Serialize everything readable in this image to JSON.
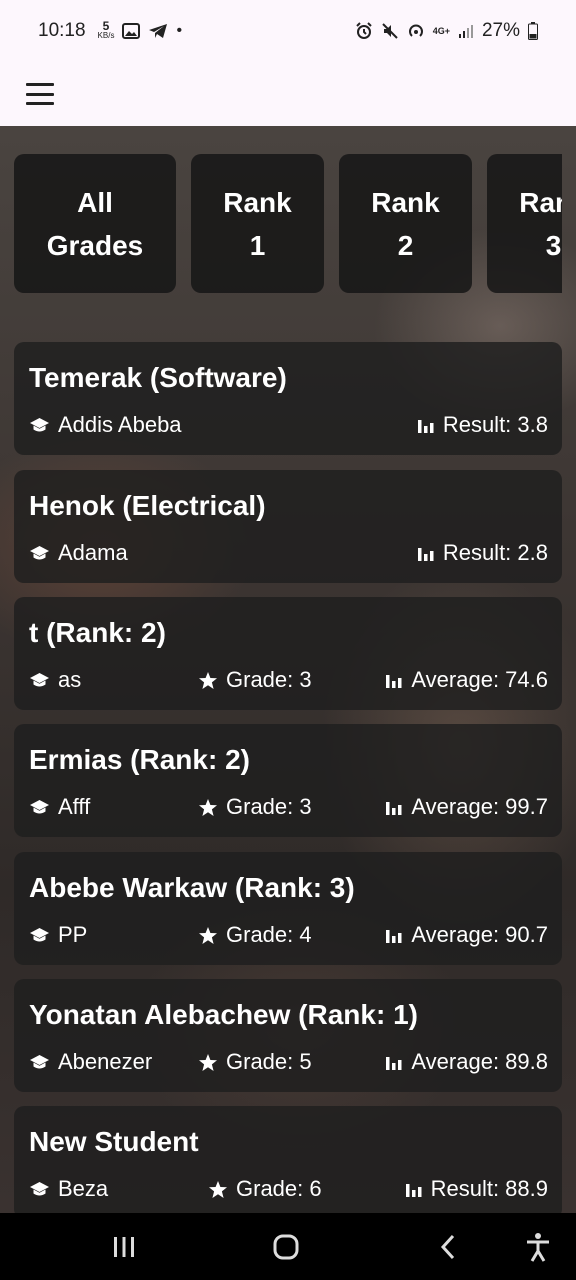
{
  "status_bar": {
    "time": "10:18",
    "net_speed": "5",
    "net_unit": "KB/s",
    "left_icons": [
      "image-icon",
      "telegram-icon",
      "dot-icon"
    ],
    "right_icons": [
      "alarm-icon",
      "mute-icon",
      "hotspot-icon",
      "lte-icon",
      "signal-icon"
    ],
    "network": "4G+",
    "battery": "27%"
  },
  "filters": [
    {
      "line1": "All",
      "line2": "Grades"
    },
    {
      "line1": "Rank",
      "line2": "1"
    },
    {
      "line1": "Rank",
      "line2": "2"
    },
    {
      "line1": "Rank",
      "line2": "3"
    }
  ],
  "students": [
    {
      "title": "Temerak (Software)",
      "school": "Addis Abeba",
      "grade": "",
      "score": "Result: 3.8"
    },
    {
      "title": "Henok (Electrical)",
      "school": "Adama",
      "grade": "",
      "score": "Result: 2.8"
    },
    {
      "title": "t (Rank: 2)",
      "school": "as",
      "grade": "Grade: 3",
      "score": "Average: 74.6"
    },
    {
      "title": "Ermias (Rank: 2)",
      "school": "Afff",
      "grade": "Grade: 3",
      "score": "Average: 99.7"
    },
    {
      "title": "Abebe Warkaw (Rank: 3)",
      "school": "PP",
      "grade": "Grade: 4",
      "score": "Average: 90.7"
    },
    {
      "title": "Yonatan Alebachew (Rank: 1)",
      "school": "Abenezer",
      "grade": "Grade: 5",
      "score": "Average: 89.8"
    },
    {
      "title": "New Student",
      "school": "Beza",
      "grade": "Grade: 6",
      "score": "Result: 88.9"
    }
  ],
  "colors": {
    "card": "#1e1e1e",
    "text": "#ffffff",
    "appbar": "#fdf7fd"
  }
}
